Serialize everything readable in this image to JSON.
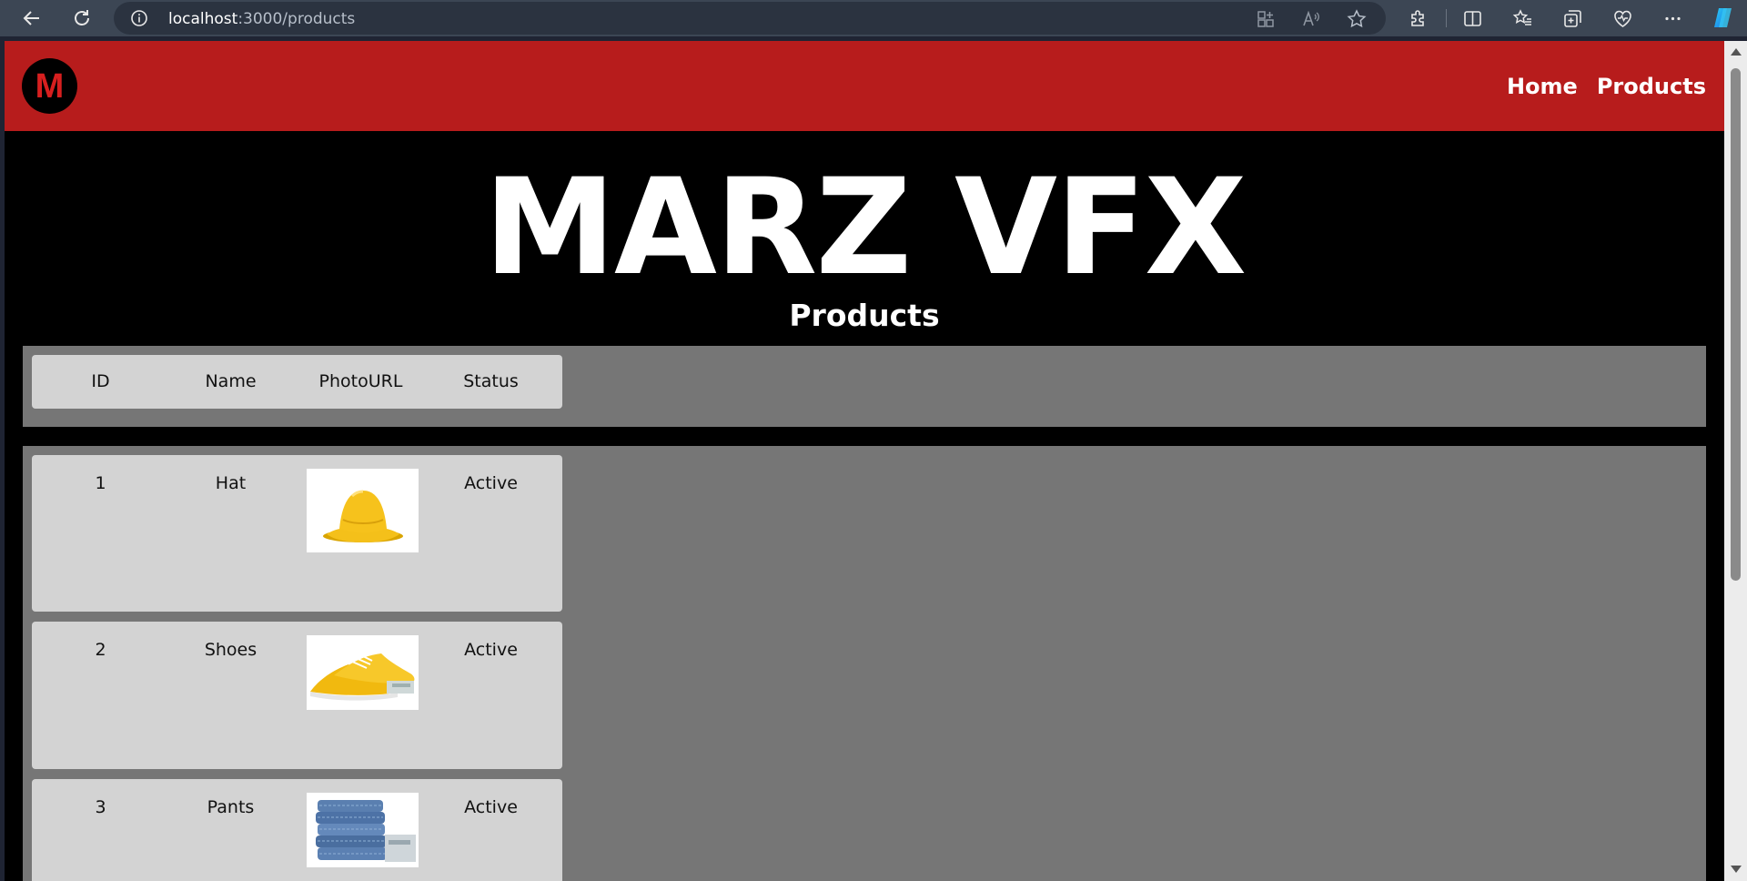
{
  "browser": {
    "url_host": "localhost",
    "url_path": ":3000/products",
    "icons": [
      "back-icon",
      "refresh-icon",
      "info-icon",
      "app-available-icon",
      "read-aloud-icon",
      "favorite-star-icon",
      "extensions-icon",
      "split-screen-icon",
      "favorites-icon",
      "collections-icon",
      "browser-essentials-icon",
      "more-icon",
      "copilot-icon"
    ]
  },
  "site": {
    "logo_letter": "M",
    "nav": {
      "home": "Home",
      "products": "Products"
    },
    "hero_title": "MARZ VFX",
    "page_title": "Products",
    "colors": {
      "header_red": "#b71c1c",
      "panel_gray": "#767676",
      "card_gray": "#d3d3d3",
      "background": "#000000"
    }
  },
  "table": {
    "headers": {
      "id": "ID",
      "name": "Name",
      "photo": "PhotoURL",
      "status": "Status"
    },
    "rows": [
      {
        "id": "1",
        "name": "Hat",
        "photo": "yellow-bucket-hat-image",
        "status": "Active"
      },
      {
        "id": "2",
        "name": "Shoes",
        "photo": "yellow-sneakers-image",
        "status": "Active"
      },
      {
        "id": "3",
        "name": "Pants",
        "photo": "folded-jeans-stack-image",
        "status": "Active"
      }
    ]
  }
}
